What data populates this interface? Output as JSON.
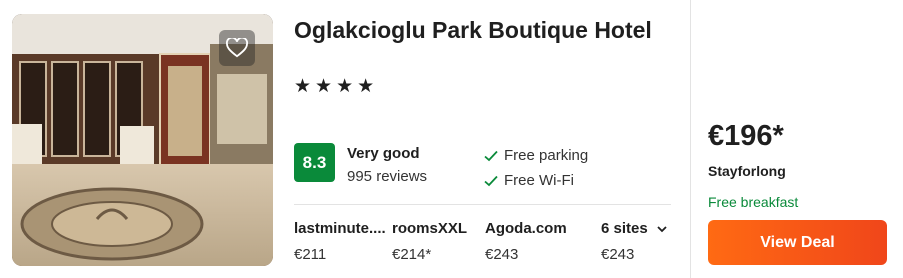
{
  "hotel": {
    "name": "Oglakcioglu Park Boutique Hotel",
    "stars_text": "★★★★",
    "star_count": 4,
    "photo_alt_icon": "hotel-lobby-photo",
    "favorite_icon": "heart-outline-icon"
  },
  "rating": {
    "score": "8.3",
    "label": "Very good",
    "reviews": "995 reviews",
    "badge_color": "#0a8a3a"
  },
  "amenities": [
    {
      "label": "Free parking",
      "icon": "check-icon"
    },
    {
      "label": "Free Wi-Fi",
      "icon": "check-icon"
    }
  ],
  "sites": [
    {
      "name": "lastminute....",
      "price": "€211"
    },
    {
      "name": "roomsXXL",
      "price": "€214*"
    },
    {
      "name": "Agoda.com",
      "price": "€243"
    },
    {
      "name": "6 sites",
      "price": "€243",
      "icon": "chevron-down-icon"
    }
  ],
  "deal": {
    "price": "€196*",
    "provider": "Stayforlong",
    "perk": "Free breakfast",
    "button_label": "View Deal",
    "button_color": "#ff6a13",
    "perk_color": "#0a8a3a"
  }
}
